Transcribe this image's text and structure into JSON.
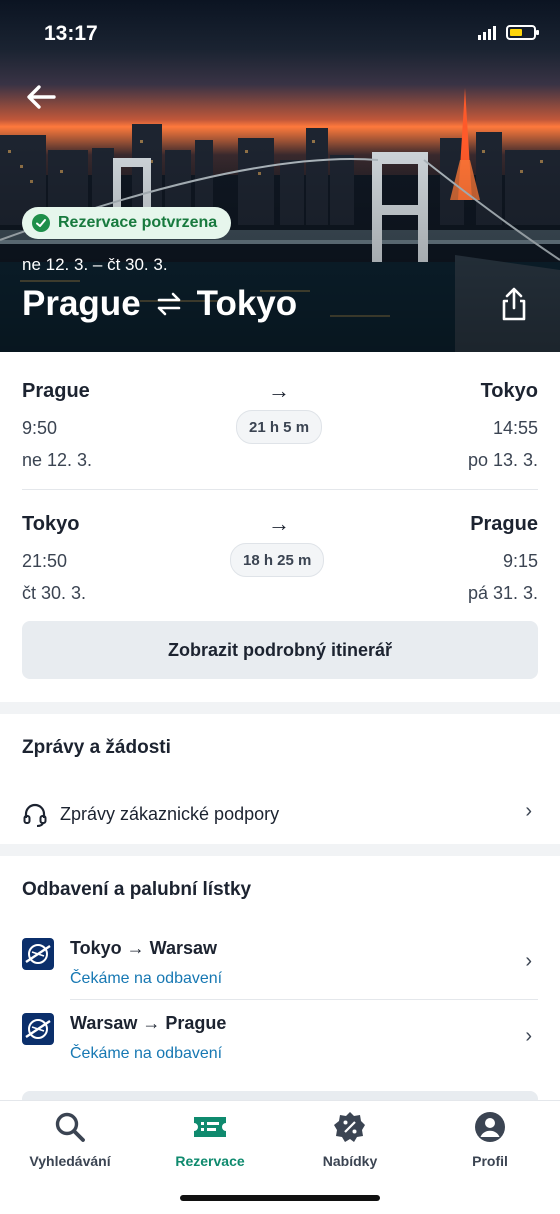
{
  "status_bar": {
    "time": "13:17",
    "battery_fill": 0.55,
    "battery_color": "#ffd60a"
  },
  "hero": {
    "badge": "Rezervace potvrzena",
    "dates": "ne 12. 3. – čt 30. 3.",
    "origin": "Prague",
    "destination": "Tokyo",
    "swap_icon": "swap-arrows-icon",
    "share_icon": "share-icon",
    "back_icon": "back-arrow-icon"
  },
  "itinerary": {
    "outbound": {
      "from": "Prague",
      "to": "Tokyo",
      "depart_time": "9:50",
      "arrive_time": "14:55",
      "depart_date": "ne 12. 3.",
      "arrive_date": "po 13. 3.",
      "duration": "21 h 5 m"
    },
    "inbound": {
      "from": "Tokyo",
      "to": "Prague",
      "depart_time": "21:50",
      "arrive_time": "9:15",
      "depart_date": "čt 30. 3.",
      "arrive_date": "pá 31. 3.",
      "duration": "18 h 25 m"
    },
    "arrow": "→",
    "detail_button": "Zobrazit podrobný itinerář"
  },
  "messages": {
    "title": "Zprávy a žádosti",
    "support_label": "Zprávy zákaznické podpory",
    "support_icon": "headset-icon"
  },
  "baggage": {
    "title": "Odbavení a palubní lístky",
    "items": [
      {
        "route": "Tokyo → Warsaw",
        "status": "Čekáme na odbavení"
      },
      {
        "route": "Warsaw → Prague",
        "status": "Čekáme na odbavení"
      }
    ],
    "chevron": "›"
  },
  "nav": {
    "items": [
      {
        "label": "Vyhledávání",
        "icon": "search-icon"
      },
      {
        "label": "Rezervace",
        "icon": "ticket-icon",
        "active": true
      },
      {
        "label": "Nabídky",
        "icon": "discount-badge-icon"
      },
      {
        "label": "Profil",
        "icon": "profile-icon"
      }
    ],
    "active_color": "#0f8a6e"
  }
}
